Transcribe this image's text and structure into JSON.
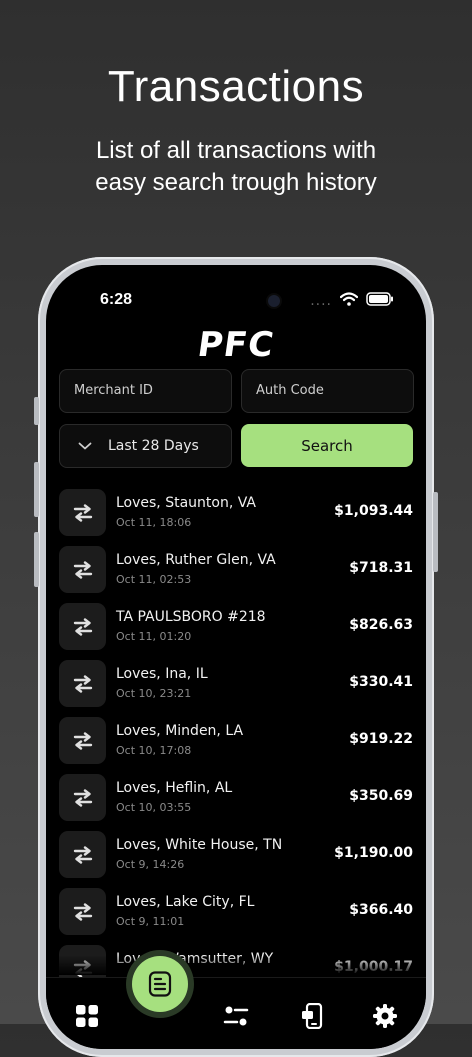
{
  "promo": {
    "title": "Transactions",
    "subtitle_line1": "List of all transactions with",
    "subtitle_line2": "easy search trough history"
  },
  "status": {
    "time": "6:28",
    "dots": "....",
    "icons": [
      "wifi-icon",
      "battery-icon"
    ]
  },
  "logo": "PFC",
  "filters": {
    "merchant_placeholder": "Merchant ID",
    "auth_placeholder": "Auth Code",
    "period": "Last 28 Days",
    "search_label": "Search"
  },
  "colors": {
    "accent": "#a6e07f",
    "background": "#000000",
    "card": "#1c1c1c"
  },
  "transactions": [
    {
      "name": "Loves, Staunton, VA",
      "date": "Oct 11, 18:06",
      "amount": "$1,093.44"
    },
    {
      "name": "Loves, Ruther Glen, VA",
      "date": "Oct 11, 02:53",
      "amount": "$718.31"
    },
    {
      "name": "TA PAULSBORO #218",
      "date": "Oct 11, 01:20",
      "amount": "$826.63"
    },
    {
      "name": "Loves, Ina, IL",
      "date": "Oct 10, 23:21",
      "amount": "$330.41"
    },
    {
      "name": "Loves, Minden, LA",
      "date": "Oct 10, 17:08",
      "amount": "$919.22"
    },
    {
      "name": "Loves, Heflin, AL",
      "date": "Oct 10, 03:55",
      "amount": "$350.69"
    },
    {
      "name": "Loves, White House, TN",
      "date": "Oct 9, 14:26",
      "amount": "$1,190.00"
    },
    {
      "name": "Loves, Lake City, FL",
      "date": "Oct 9, 11:01",
      "amount": "$366.40"
    },
    {
      "name": "Loves, Wamsutter, WY",
      "date": "",
      "amount": "$1,000.17"
    }
  ],
  "tabbar": {
    "items": [
      "dashboard-icon",
      "transactions-icon",
      "filters-icon",
      "mobile-card-icon",
      "settings-icon"
    ],
    "active": "transactions-icon"
  }
}
